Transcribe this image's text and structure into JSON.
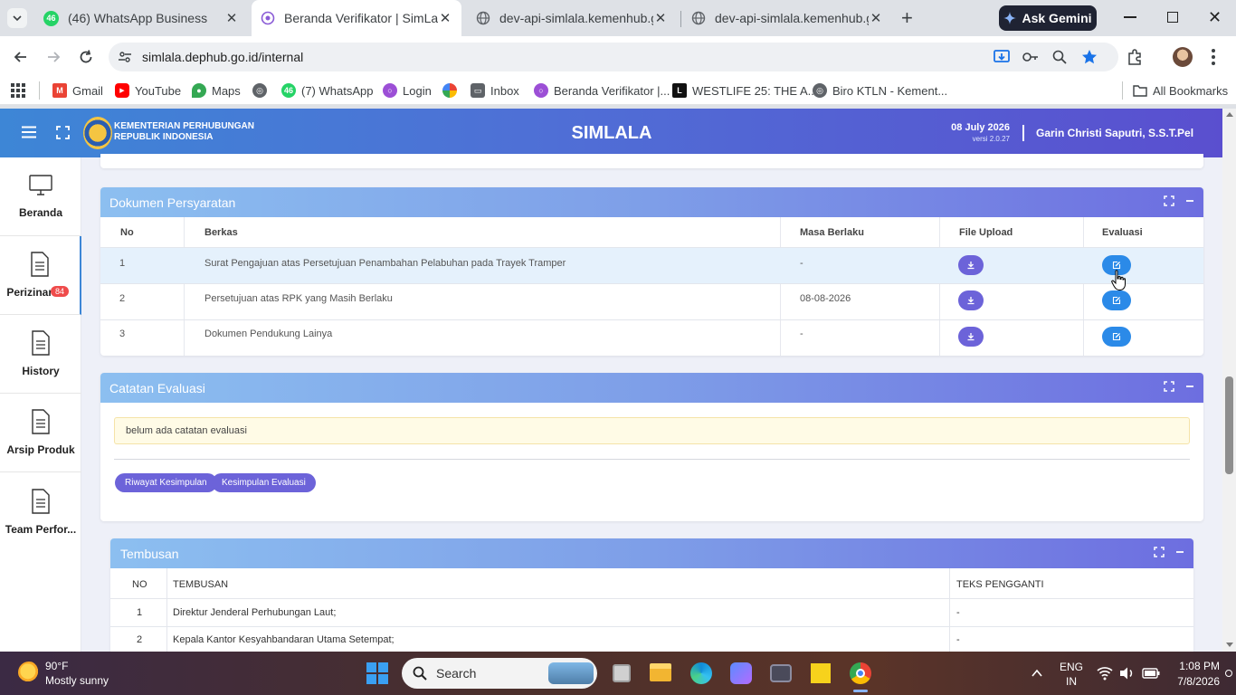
{
  "browser": {
    "tabs": [
      {
        "title": "(46) WhatsApp Business",
        "badge": "46",
        "active": false
      },
      {
        "title": "Beranda Verifikator | SimLala",
        "active": true
      },
      {
        "title": "dev-api-simlala.kemenhub.go.id",
        "active": false
      },
      {
        "title": "dev-api-simlala.kemenhub.go.id",
        "active": false
      }
    ],
    "ask_gemini": "Ask Gemini",
    "url": "simlala.dephub.go.id/internal",
    "bookmarks": [
      {
        "label": "Gmail",
        "color": "#ea4335"
      },
      {
        "label": "YouTube",
        "color": "#ff0000"
      },
      {
        "label": "Maps",
        "color": "#34a853"
      },
      {
        "label": "",
        "color": "#5f6368"
      },
      {
        "label": "(7) WhatsApp",
        "color": "#25d366",
        "badge": "46"
      },
      {
        "label": "Login",
        "color": "#9c4fd6"
      },
      {
        "label": "",
        "color": "#fbbc04"
      },
      {
        "label": "Inbox",
        "color": "#5f6368"
      },
      {
        "label": "Beranda Verifikator |...",
        "color": "#9c4fd6"
      },
      {
        "label": "WESTLIFE 25: THE A...",
        "color": "#111111"
      },
      {
        "label": "Biro KTLN - Kement...",
        "color": "#5f6368"
      }
    ],
    "all_bookmarks": "All Bookmarks"
  },
  "app": {
    "logo_line1": "KEMENTERIAN PERHUBUNGAN",
    "logo_line2": "REPUBLIK INDONESIA",
    "title": "SIMLALA",
    "date": "08 July 2026",
    "version": "versi 2.0.27",
    "user": "Garin Christi Saputri, S.S.T.Pel"
  },
  "sidebar": {
    "items": [
      {
        "label": "Beranda",
        "icon": "monitor-icon"
      },
      {
        "label": "Perizinan",
        "icon": "document-icon",
        "badge": "84"
      },
      {
        "label": "History",
        "icon": "document-icon"
      },
      {
        "label": "Arsip Produk",
        "icon": "document-icon"
      },
      {
        "label": "Team Perfor...",
        "icon": "document-icon"
      }
    ]
  },
  "dokumen": {
    "title": "Dokumen Persyaratan",
    "headers": [
      "No",
      "Berkas",
      "Masa Berlaku",
      "File Upload",
      "Evaluasi"
    ],
    "rows": [
      {
        "no": "1",
        "berkas": "Surat Pengajuan atas Persetujuan Penambahan Pelabuhan pada Trayek Tramper",
        "masa": "-"
      },
      {
        "no": "2",
        "berkas": "Persetujuan atas RPK yang Masih Berlaku",
        "masa": "08-08-2026"
      },
      {
        "no": "3",
        "berkas": "Dokumen Pendukung Lainya",
        "masa": "-"
      }
    ]
  },
  "catatan": {
    "title": "Catatan Evaluasi",
    "note": "belum ada catatan evaluasi",
    "btn_riwayat": "Riwayat Kesimpulan",
    "btn_kesimpulan": "Kesimpulan Evaluasi"
  },
  "tembusan": {
    "title": "Tembusan",
    "headers": [
      "NO",
      "TEMBUSAN",
      "TEKS PENGGANTI"
    ],
    "rows": [
      {
        "no": "1",
        "tembusan": "Direktur Jenderal Perhubungan Laut;",
        "teks": "-"
      },
      {
        "no": "2",
        "tembusan": "Kepala Kantor Kesyahbandaran Utama Setempat;",
        "teks": "-"
      }
    ]
  },
  "taskbar": {
    "temp": "90°F",
    "weather": "Mostly sunny",
    "search": "Search",
    "lang1": "ENG",
    "lang2": "IN",
    "time": "1:08 PM",
    "date": "7/8/2026"
  }
}
